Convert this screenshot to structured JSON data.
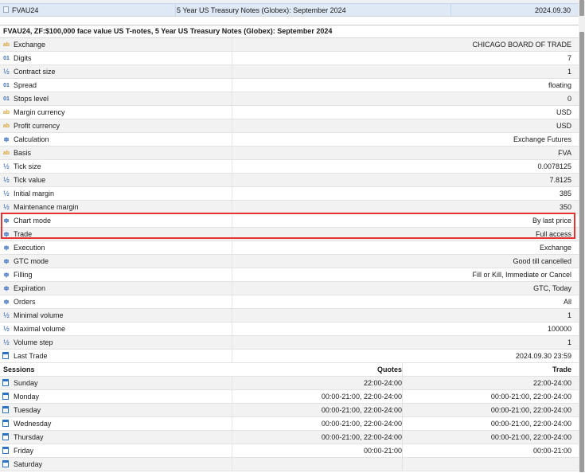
{
  "symbol_list": {
    "row": {
      "symbol": "FVAU24",
      "description": "5 Year US Treasury Notes (Globex): September 2024",
      "expiration": "2024.09.30"
    }
  },
  "spec": {
    "title": "FVAU24, ZF:$100,000 face value US T-notes, 5 Year US Treasury Notes (Globex): September 2024",
    "rows": [
      {
        "icon": "ab",
        "label": "Exchange",
        "value": "CHICAGO BOARD OF TRADE"
      },
      {
        "icon": "num",
        "label": "Digits",
        "value": "7"
      },
      {
        "icon": "frac",
        "label": "Contract size",
        "value": "1"
      },
      {
        "icon": "num",
        "label": "Spread",
        "value": "floating"
      },
      {
        "icon": "num",
        "label": "Stops level",
        "value": "0"
      },
      {
        "icon": "ab",
        "label": "Margin currency",
        "value": "USD"
      },
      {
        "icon": "ab",
        "label": "Profit currency",
        "value": "USD"
      },
      {
        "icon": "menu",
        "label": "Calculation",
        "value": "Exchange Futures"
      },
      {
        "icon": "ab",
        "label": "Basis",
        "value": "FVA"
      },
      {
        "icon": "frac",
        "label": "Tick size",
        "value": "0.0078125"
      },
      {
        "icon": "frac",
        "label": "Tick value",
        "value": "7.8125"
      },
      {
        "icon": "frac",
        "label": "Initial margin",
        "value": "385"
      },
      {
        "icon": "frac",
        "label": "Maintenance margin",
        "value": "350"
      },
      {
        "icon": "menu",
        "label": "Chart mode",
        "value": "By last price"
      },
      {
        "icon": "menu",
        "label": "Trade",
        "value": "Full access"
      },
      {
        "icon": "menu",
        "label": "Execution",
        "value": "Exchange"
      },
      {
        "icon": "menu",
        "label": "GTC mode",
        "value": "Good till cancelled"
      },
      {
        "icon": "menu",
        "label": "Filling",
        "value": "Fill or Kill, Immediate or Cancel"
      },
      {
        "icon": "menu",
        "label": "Expiration",
        "value": "GTC, Today"
      },
      {
        "icon": "menu",
        "label": "Orders",
        "value": "All"
      },
      {
        "icon": "frac",
        "label": "Minimal volume",
        "value": "1"
      },
      {
        "icon": "frac",
        "label": "Maximal volume",
        "value": "100000"
      },
      {
        "icon": "frac",
        "label": "Volume step",
        "value": "1"
      },
      {
        "icon": "cal",
        "label": "Last Trade",
        "value": "2024.09.30 23:59"
      }
    ],
    "icon_glyphs": {
      "ab": "ab",
      "num": "01",
      "frac": "½",
      "menu": "≑"
    }
  },
  "sessions": {
    "header": {
      "label": "Sessions",
      "quotes": "Quotes",
      "trade": "Trade"
    },
    "rows": [
      {
        "day": "Sunday",
        "quotes": "22:00-24:00",
        "trade": "22:00-24:00"
      },
      {
        "day": "Monday",
        "quotes": "00:00-21:00, 22:00-24:00",
        "trade": "00:00-21:00, 22:00-24:00"
      },
      {
        "day": "Tuesday",
        "quotes": "00:00-21:00, 22:00-24:00",
        "trade": "00:00-21:00, 22:00-24:00"
      },
      {
        "day": "Wednesday",
        "quotes": "00:00-21:00, 22:00-24:00",
        "trade": "00:00-21:00, 22:00-24:00"
      },
      {
        "day": "Thursday",
        "quotes": "00:00-21:00, 22:00-24:00",
        "trade": "00:00-21:00, 22:00-24:00"
      },
      {
        "day": "Friday",
        "quotes": "00:00-21:00",
        "trade": "00:00-21:00"
      },
      {
        "day": "Saturday",
        "quotes": "",
        "trade": ""
      }
    ]
  },
  "colors": {
    "highlight": "#e53333",
    "selected_row": "#dfe9f6"
  }
}
